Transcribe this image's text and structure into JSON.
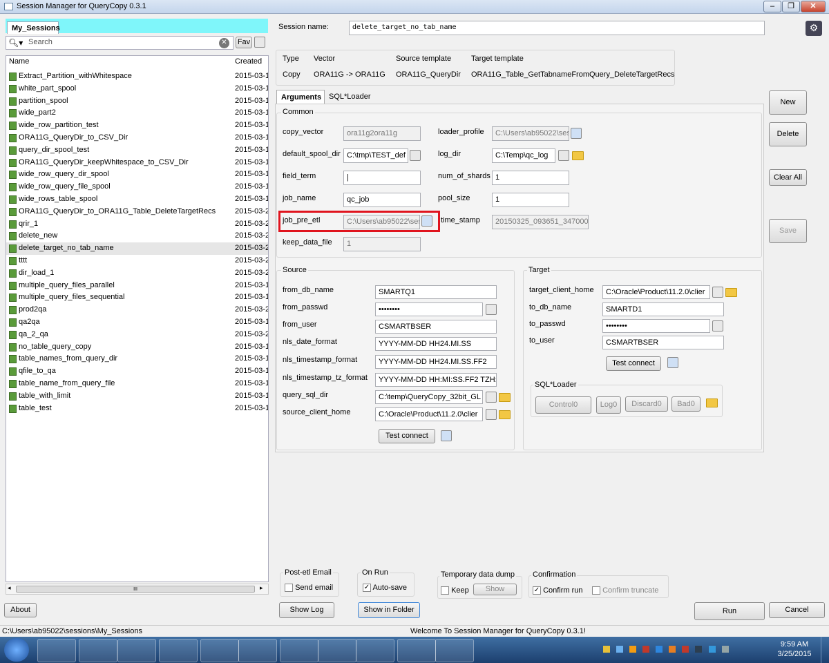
{
  "window": {
    "title": "Session Manager for QueryCopy 0.3.1",
    "min": "–",
    "max": "❐",
    "close": "✕"
  },
  "left": {
    "tab": "My_Sessions",
    "search_placeholder": "Search",
    "fav": "Fav",
    "col_name": "Name",
    "col_created": "Created",
    "sessions": [
      {
        "name": "Extract_Partition_withWhitespace",
        "created": "2015-03-1"
      },
      {
        "name": "white_part_spool",
        "created": "2015-03-1"
      },
      {
        "name": "partition_spool",
        "created": "2015-03-1"
      },
      {
        "name": "wide_part2",
        "created": "2015-03-1"
      },
      {
        "name": "wide_row_partition_test",
        "created": "2015-03-1"
      },
      {
        "name": "ORA11G_QueryDir_to_CSV_Dir",
        "created": "2015-03-1"
      },
      {
        "name": "query_dir_spool_test",
        "created": "2015-03-1"
      },
      {
        "name": "ORA11G_QueryDir_keepWhitespace_to_CSV_Dir",
        "created": "2015-03-1"
      },
      {
        "name": "wide_row_query_dir_spool",
        "created": "2015-03-1"
      },
      {
        "name": "wide_row_query_file_spool",
        "created": "2015-03-1"
      },
      {
        "name": "wide_rows_table_spool",
        "created": "2015-03-1"
      },
      {
        "name": "ORA11G_QueryDir_to_ORA11G_Table_DeleteTargetRecs",
        "created": "2015-03-2"
      },
      {
        "name": "qrir_1",
        "created": "2015-03-2"
      },
      {
        "name": "delete_new",
        "created": "2015-03-2"
      },
      {
        "name": "delete_target_no_tab_name",
        "created": "2015-03-2"
      },
      {
        "name": "tttt",
        "created": "2015-03-2"
      },
      {
        "name": "dir_load_1",
        "created": "2015-03-2"
      },
      {
        "name": "multiple_query_files_parallel",
        "created": "2015-03-1"
      },
      {
        "name": "multiple_query_files_sequential",
        "created": "2015-03-1"
      },
      {
        "name": "prod2qa",
        "created": "2015-03-2"
      },
      {
        "name": "qa2qa",
        "created": "2015-03-1"
      },
      {
        "name": "qa_2_qa",
        "created": "2015-03-2"
      },
      {
        "name": "no_table_query_copy",
        "created": "2015-03-1"
      },
      {
        "name": "table_names_from_query_dir",
        "created": "2015-03-1"
      },
      {
        "name": "qfile_to_qa",
        "created": "2015-03-1"
      },
      {
        "name": "table_name_from_query_file",
        "created": "2015-03-1"
      },
      {
        "name": "table_with_limit",
        "created": "2015-03-1"
      },
      {
        "name": "table_test",
        "created": "2015-03-1"
      }
    ],
    "scroll_grip": "III",
    "about": "About"
  },
  "header": {
    "session_label": "Session name:",
    "session_name": "delete_target_no_tab_name",
    "type_h": "Type",
    "type_v": "Copy",
    "vector_h": "Vector",
    "vector_v": "ORA11G -> ORA11G",
    "src_h": "Source template",
    "src_v": "ORA11G_QueryDir",
    "tgt_h": "Target template",
    "tgt_v": "ORA11G_Table_GetTabnameFromQuery_DeleteTargetRecs"
  },
  "tabs": {
    "args": "Arguments",
    "sqlldr": "SQL*Loader"
  },
  "common": {
    "title": "Common",
    "copy_vector_l": "copy_vector",
    "copy_vector_v": "ora11g2ora11g",
    "default_spool_dir_l": "default_spool_dir",
    "default_spool_dir_v": "C:\\tmp\\TEST_def",
    "field_term_l": "field_term",
    "field_term_v": "|",
    "job_name_l": "job_name",
    "job_name_v": "qc_job",
    "job_pre_etl_l": "job_pre_etl",
    "job_pre_etl_v": "C:\\Users\\ab95022\\ses",
    "keep_data_file_l": "keep_data_file",
    "keep_data_file_v": "1",
    "loader_profile_l": "loader_profile",
    "loader_profile_v": "C:\\Users\\ab95022\\ses",
    "log_dir_l": "log_dir",
    "log_dir_v": "C:\\Temp\\qc_log",
    "num_of_shards_l": "num_of_shards",
    "num_of_shards_v": "1",
    "pool_size_l": "pool_size",
    "pool_size_v": "1",
    "time_stamp_l": "time_stamp",
    "time_stamp_v": "20150325_093651_347000"
  },
  "source": {
    "title": "Source",
    "from_db_name_l": "from_db_name",
    "from_db_name_v": "SMARTQ1",
    "from_passwd_l": "from_passwd",
    "from_passwd_v": "••••••••",
    "from_user_l": "from_user",
    "from_user_v": "CSMARTBSER",
    "nls_date_format_l": "nls_date_format",
    "nls_date_format_v": "YYYY-MM-DD HH24.MI.SS",
    "nls_timestamp_format_l": "nls_timestamp_format",
    "nls_timestamp_format_v": "YYYY-MM-DD HH24.MI.SS.FF2",
    "nls_timestamp_tz_format_l": "nls_timestamp_tz_format",
    "nls_timestamp_tz_format_v": "YYYY-MM-DD HH:MI:SS.FF2 TZH:",
    "query_sql_dir_l": "query_sql_dir",
    "query_sql_dir_v": "C:\\temp\\QueryCopy_32bit_GL",
    "source_client_home_l": "source_client_home",
    "source_client_home_v": "C:\\Oracle\\Product\\11.2.0\\clier",
    "test_connect": "Test connect"
  },
  "target": {
    "title": "Target",
    "target_client_home_l": "target_client_home",
    "target_client_home_v": "C:\\Oracle\\Product\\11.2.0\\clier",
    "to_db_name_l": "to_db_name",
    "to_db_name_v": "SMARTD1",
    "to_passwd_l": "to_passwd",
    "to_passwd_v": "••••••••",
    "to_user_l": "to_user",
    "to_user_v": "CSMARTBSER",
    "test_connect": "Test connect",
    "sqlldr_title": "SQL*Loader",
    "control": "Control0",
    "log": "Log0",
    "discard": "Discard0",
    "bad": "Bad0"
  },
  "side": {
    "new": "New",
    "delete": "Delete",
    "clear_all": "Clear All",
    "save": "Save"
  },
  "bottom": {
    "post_etl": "Post-etl Email",
    "send_email": "Send email",
    "on_run": "On Run",
    "auto_save": "Auto-save",
    "temp_dump": "Temporary data dump",
    "keep": "Keep",
    "show": "Show",
    "confirmation": "Confirmation",
    "confirm_run": "Confirm run",
    "confirm_truncate": "Confirm truncate",
    "show_log": "Show Log",
    "show_in_folder": "Show in Folder",
    "run": "Run",
    "cancel": "Cancel"
  },
  "status": {
    "path": "C:\\Users\\ab95022\\sessions\\My_Sessions",
    "message": "Welcome To Session Manager for QueryCopy 0.3.1!"
  },
  "taskbar": {
    "time": "9:59 AM",
    "date": "3/25/2015"
  },
  "colors": {
    "highlight_box": "#e0141e",
    "tab_strip": "#7ff6fa"
  }
}
